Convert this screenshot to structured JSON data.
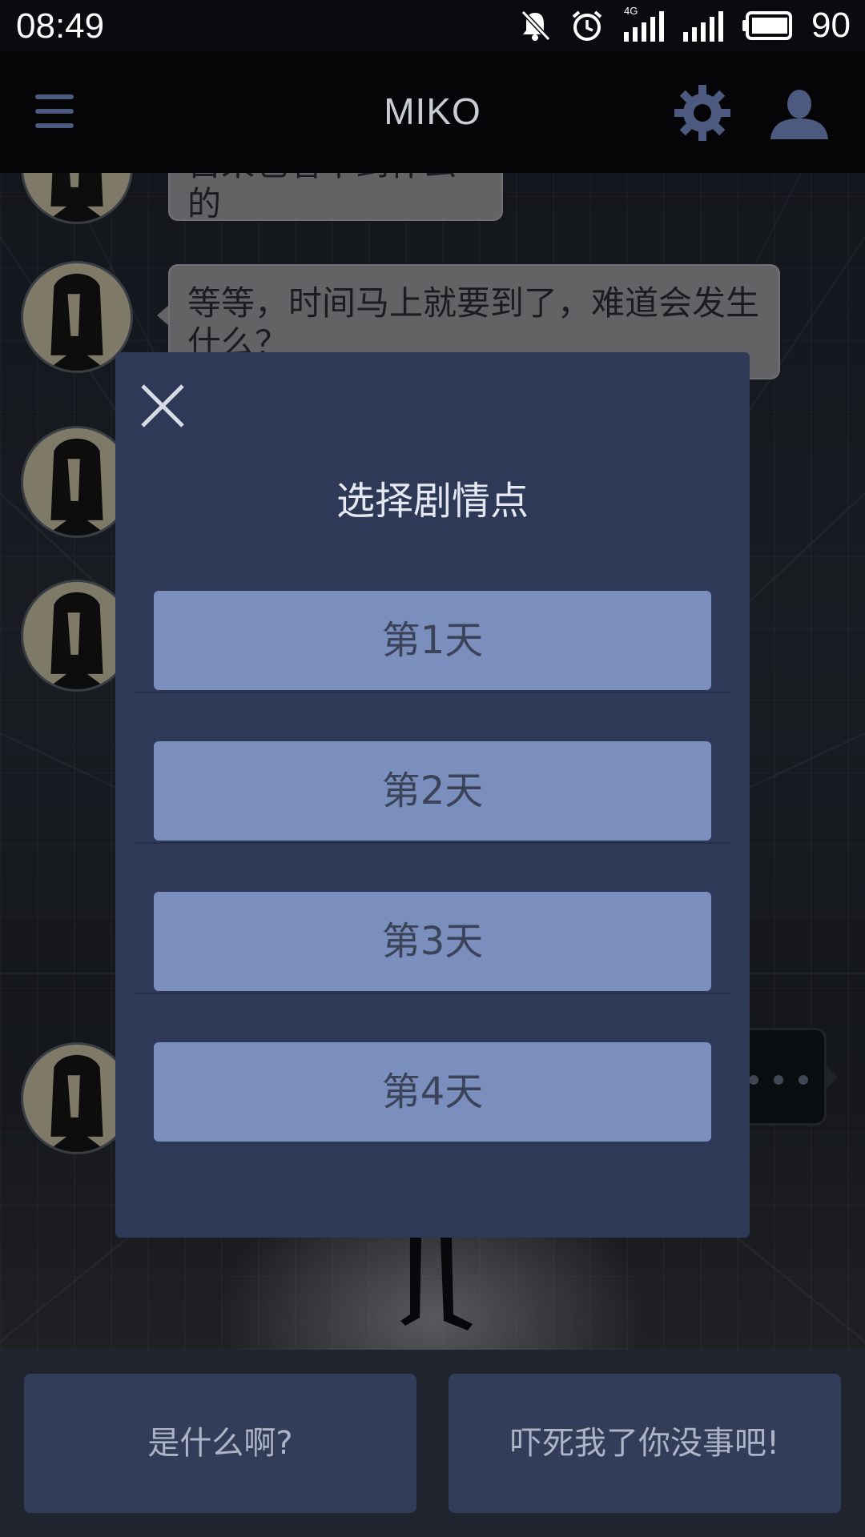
{
  "status_bar": {
    "time": "08:49",
    "network_label": "4G",
    "battery": "90",
    "icons": [
      "bell-muted-icon",
      "alarm-icon",
      "signal-4g-icon",
      "signal-icon",
      "battery-icon"
    ]
  },
  "app_bar": {
    "title": "MIKO",
    "icons": [
      "menu-icon",
      "gear-icon",
      "user-icon"
    ],
    "accent_color": "#4b5a7e"
  },
  "chat": {
    "messages": [
      {
        "text": "自来也看不到什么的"
      },
      {
        "text": "等等，时间马上就要到了，难道会发生什么？"
      }
    ]
  },
  "dialog": {
    "title": "选择剧情点",
    "close_icon": "close-icon",
    "options": [
      {
        "label": "第1天"
      },
      {
        "label": "第2天"
      },
      {
        "label": "第3天"
      },
      {
        "label": "第4天"
      }
    ],
    "colors": {
      "background": "#2d3957",
      "button": "#7b8fbe",
      "button_text": "#3a4357"
    }
  },
  "replies": [
    {
      "label": "是什么啊?"
    },
    {
      "label": "吓死我了你没事吧!"
    }
  ]
}
